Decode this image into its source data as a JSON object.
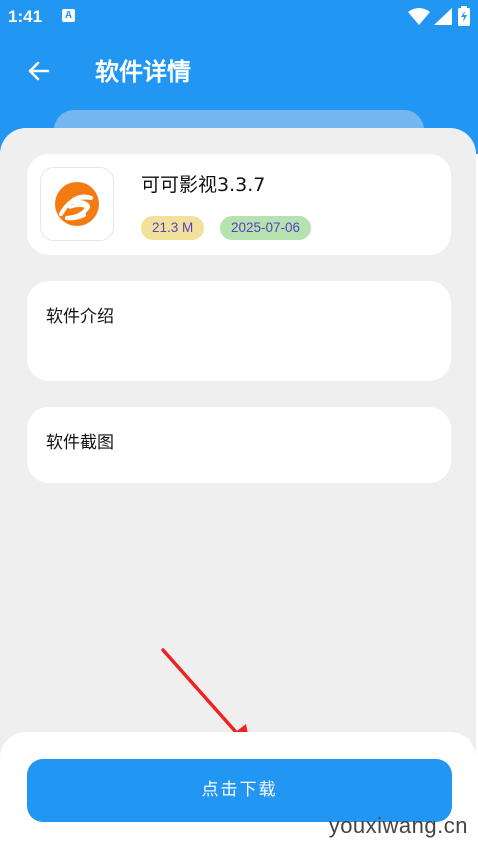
{
  "status_bar": {
    "time": "1:41",
    "notification_badge": "A",
    "icons": [
      "wifi-icon",
      "cell-signal-icon",
      "battery-charging-icon"
    ]
  },
  "header": {
    "back_icon": "arrow-left-icon",
    "title": "软件详情"
  },
  "app": {
    "name": "可可影视3.3.7",
    "size": "21.3 M",
    "date": "2025-07-06",
    "icon": "keke-app-logo-icon"
  },
  "sections": {
    "intro_title": "软件介绍",
    "screenshots_title": "软件截图"
  },
  "actions": {
    "download_label": "点击下载"
  },
  "watermark": "youxiwang.cn",
  "colors": {
    "primary": "#2196f3",
    "background": "#efefef",
    "size_badge": "#f2e19a",
    "date_badge": "#b6e2b0",
    "badge_text": "#5a3fc0",
    "annotation_arrow": "#ee2222",
    "logo_orange": "#f47b12"
  }
}
